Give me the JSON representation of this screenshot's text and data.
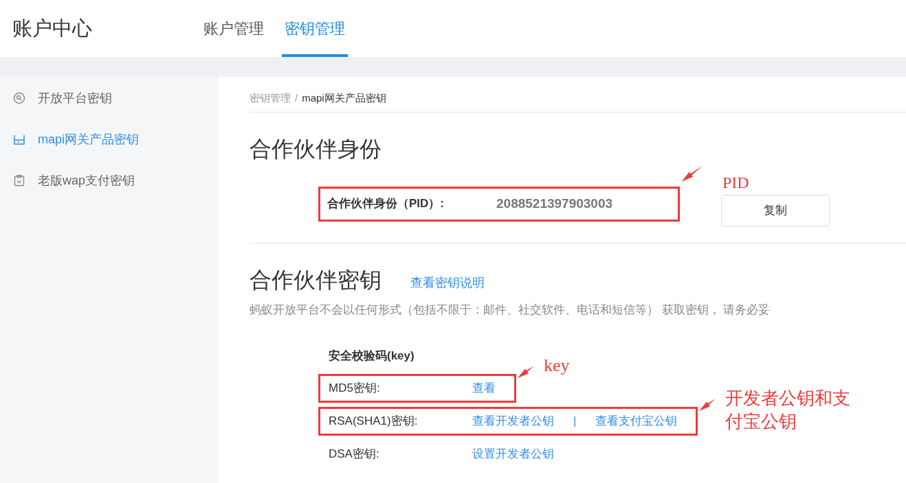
{
  "header": {
    "title": "账户中心",
    "tabs": [
      {
        "label": "账户管理",
        "selected": false
      },
      {
        "label": "密钥管理",
        "selected": true
      }
    ]
  },
  "sidebar": {
    "items": [
      {
        "label": "开放平台密钥",
        "kind": "search",
        "selected": false
      },
      {
        "label": "mapi网关产品密钥",
        "kind": "router",
        "selected": true
      },
      {
        "label": "老版wap支付密钥",
        "kind": "clipboard",
        "selected": false
      }
    ]
  },
  "breadcrumb": {
    "items": [
      "密钥管理",
      "mapi网关产品密钥"
    ],
    "separator": "/"
  },
  "identity": {
    "heading": "合作伙伴身份",
    "label": "合作伙伴身份（PID）:",
    "value": "2088521397903003",
    "button": "复制",
    "annotation": "PID"
  },
  "keys": {
    "heading": "合作伙伴密钥",
    "help_link": "查看密钥说明",
    "notice": "蚂蚁开放平台不会以任何形式（包括不限于：邮件、社交软件、电话和短信等） 获取密钥， 请务必妥",
    "section_title": "安全校验码(key)",
    "rows": [
      {
        "label": "MD5密钥:",
        "links": [
          "查看"
        ],
        "annotation": "key"
      },
      {
        "label": "RSA(SHA1)密钥:",
        "links": [
          "查看开发者公钥",
          "查看支付宝公钥"
        ],
        "separator": "|",
        "annotation": "开发者公钥和支付宝公钥"
      },
      {
        "label": "DSA密钥:",
        "links": [
          "设置开发者公钥"
        ]
      }
    ]
  }
}
